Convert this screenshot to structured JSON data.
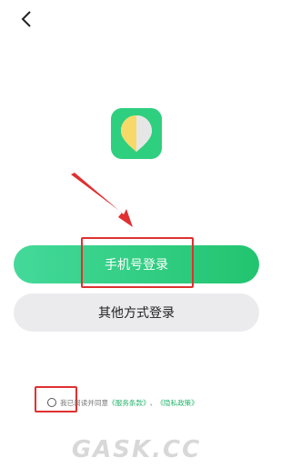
{
  "nav": {
    "back_icon": "chevron-left-icon"
  },
  "logo": {
    "icon": "app-logo-icon",
    "brand_color": "#2ecf7e"
  },
  "login_phone_label": "手机号登录",
  "login_other_label": "其他方式登录",
  "agreement": {
    "prefix": "我已阅读并同意",
    "terms_link": "《服务条款》",
    "separator": "、",
    "privacy_link": "《隐私政策》",
    "checked": false
  },
  "watermark_text": "GASK.CC",
  "colors": {
    "primary_green": "#2ecf7e",
    "secondary_button": "#ebebee",
    "link": "#22b46a",
    "annotation_red": "#e03030"
  }
}
